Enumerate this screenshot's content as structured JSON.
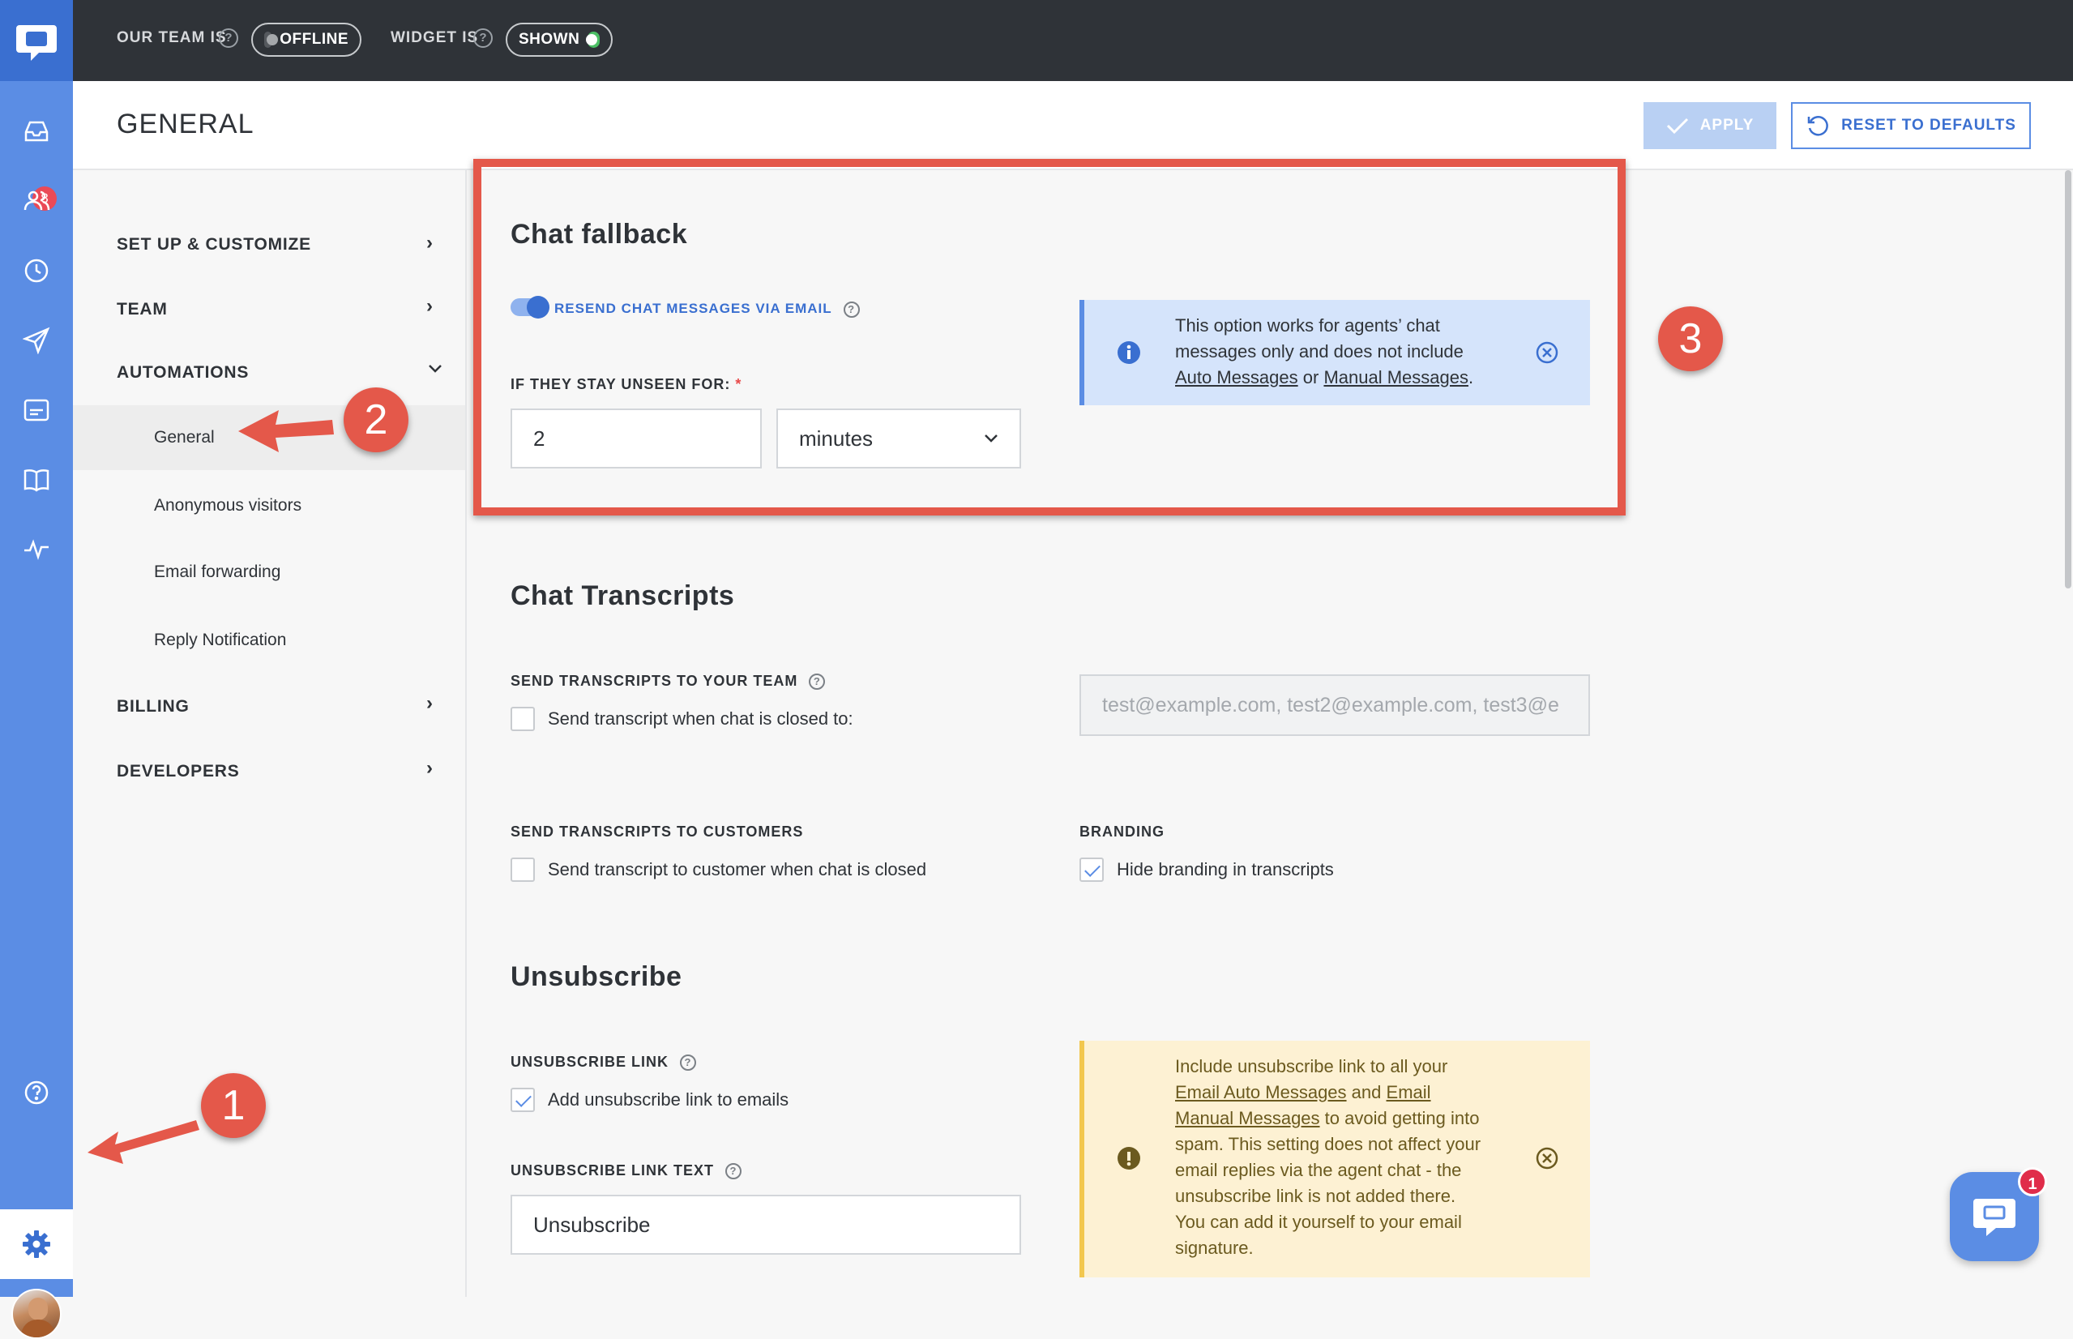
{
  "topbar": {
    "team_label": "OUR TEAM IS",
    "team_status": "OFFLINE",
    "widget_label": "WIDGET IS",
    "widget_status": "SHOWN"
  },
  "rail": {
    "inbox_badge": "8",
    "icons": [
      "logo-icon",
      "inbox-icon",
      "team-icon",
      "clock-icon",
      "send-icon",
      "widget-icon",
      "book-icon",
      "pulse-icon",
      "help-icon",
      "gear-icon",
      "avatar"
    ]
  },
  "header": {
    "title": "GENERAL",
    "apply_label": "APPLY",
    "reset_label": "RESET TO DEFAULTS"
  },
  "nav": {
    "setup": "SET UP & CUSTOMIZE",
    "team": "TEAM",
    "automations": "AUTOMATIONS",
    "sub_general": "General",
    "sub_anonymous": "Anonymous visitors",
    "sub_email_forwarding": "Email forwarding",
    "sub_reply_notification": "Reply Notification",
    "billing": "BILLING",
    "developers": "DEVELOPERS"
  },
  "chat_fallback": {
    "title": "Chat fallback",
    "toggle_label": "RESEND CHAT MESSAGES VIA EMAIL",
    "unseen_label": "IF THEY STAY UNSEEN FOR:",
    "unseen_value": "2",
    "unit_value": "minutes",
    "info_text_1": "This option works for agents’ chat",
    "info_text_2": "messages only and does not include",
    "info_link_1": "Auto Messages",
    "info_or": "or",
    "info_link_2": "Manual Messages",
    "info_end": "."
  },
  "transcripts": {
    "title": "Chat Transcripts",
    "team_label": "SEND TRANSCRIPTS TO YOUR TEAM",
    "team_checkbox": "Send transcript when chat is closed to:",
    "team_email_placeholder": "test@example.com, test2@example.com, test3@e",
    "customers_label": "SEND TRANSCRIPTS TO CUSTOMERS",
    "customers_checkbox": "Send transcript to customer when chat is closed",
    "branding_label": "BRANDING",
    "branding_checkbox": "Hide branding in transcripts"
  },
  "unsubscribe": {
    "title": "Unsubscribe",
    "link_label": "UNSUBSCRIBE LINK",
    "link_checkbox": "Add unsubscribe link to emails",
    "text_label": "UNSUBSCRIBE LINK TEXT",
    "text_value": "Unsubscribe",
    "warn_1": "Include unsubscribe link to all your",
    "warn_link_1": "Email Auto Messages",
    "warn_and": "and",
    "warn_link_2a": "Email",
    "warn_link_2b": "Manual Messages",
    "warn_2": "to avoid getting into",
    "warn_3": "spam. This setting does not affect your",
    "warn_4": "email replies via the agent chat - the",
    "warn_5": "unsubscribe link is not added there.",
    "warn_6": "You can add it yourself to your email",
    "warn_7": "signature."
  },
  "annotations": {
    "step1": "1",
    "step2": "2",
    "step3": "3"
  },
  "chat_widget": {
    "badge": "1"
  },
  "colors": {
    "topbar": "#2f3338",
    "rail": "#5b8de4",
    "accent": "#3a6fd0",
    "annotation": "#e4584a",
    "info_bg": "#d5e4fb",
    "warn_bg": "#fdf1d3"
  }
}
